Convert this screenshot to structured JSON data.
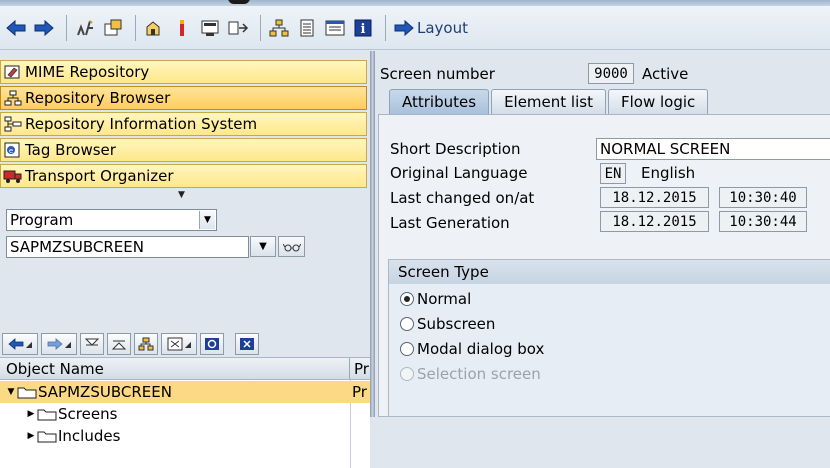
{
  "toolbar": {
    "icons": [
      "back-arrow-icon",
      "forward-arrow-icon",
      "edit-toggle-icon",
      "other-object-icon",
      "check-icon",
      "activate-icon",
      "test-icon",
      "where-used-icon",
      "navigate-icon",
      "object-list-icon",
      "display-list-icon",
      "help-icon"
    ],
    "layout_label": "Layout"
  },
  "navigator": {
    "items": [
      {
        "label": "MIME Repository",
        "icon": "mime-repository-icon",
        "active": false
      },
      {
        "label": "Repository Browser",
        "icon": "repository-browser-icon",
        "active": true
      },
      {
        "label": "Repository Information System",
        "icon": "repository-info-icon",
        "active": false
      },
      {
        "label": "Tag Browser",
        "icon": "tag-browser-icon",
        "active": false
      },
      {
        "label": "Transport Organizer",
        "icon": "transport-organizer-icon",
        "active": false
      }
    ],
    "object_type": "Program",
    "object_name": "SAPMZSUBCREEN"
  },
  "tree": {
    "columns": [
      "Object Name",
      "Pr"
    ],
    "rows": [
      {
        "label": "SAPMZSUBCREEN",
        "level": 0,
        "expanded": true,
        "selected": true
      },
      {
        "label": "Screens",
        "level": 1,
        "expanded": false,
        "selected": false
      },
      {
        "label": "Includes",
        "level": 1,
        "expanded": false,
        "selected": false
      }
    ]
  },
  "screen": {
    "number_label": "Screen number",
    "number": "9000",
    "status": "Active",
    "tabs": [
      {
        "label": "Attributes",
        "active": true
      },
      {
        "label": "Element list",
        "active": false
      },
      {
        "label": "Flow logic",
        "active": false
      }
    ],
    "attributes": {
      "short_desc_label": "Short Description",
      "short_desc": "NORMAL SCREEN",
      "orig_lang_label": "Original Language",
      "orig_lang_code": "EN",
      "orig_lang_name": "English",
      "last_changed_label": "Last changed on/at",
      "last_changed_date": "18.12.2015",
      "last_changed_time": "10:30:40",
      "last_gen_label": "Last Generation",
      "last_gen_date": "18.12.2015",
      "last_gen_time": "10:30:44"
    },
    "screen_type": {
      "title": "Screen Type",
      "options": [
        {
          "label": "Normal",
          "selected": true,
          "disabled": false
        },
        {
          "label": "Subscreen",
          "selected": false,
          "disabled": false
        },
        {
          "label": "Modal dialog box",
          "selected": false,
          "disabled": false
        },
        {
          "label": "Selection screen",
          "selected": false,
          "disabled": true
        }
      ]
    }
  }
}
